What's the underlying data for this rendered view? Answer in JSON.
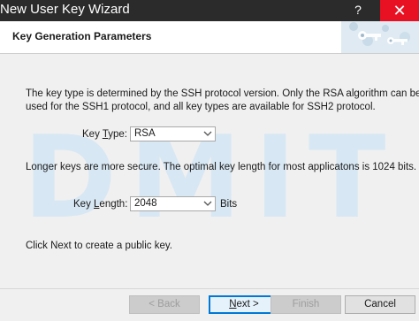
{
  "window": {
    "title": "New User Key Wizard",
    "help_label": "?",
    "close_label": "✕"
  },
  "header": {
    "title": "Key Generation Parameters"
  },
  "watermark": "DMIT",
  "content": {
    "intro_line1": "The key type is determined by the SSH protocol version. Only the RSA algorithm can be",
    "intro_line2": "used for the SSH1 protocol, and all key types are available for SSH2 protocol.",
    "key_type_label_pre": "Key ",
    "key_type_label_ul": "T",
    "key_type_label_post": "ype:",
    "key_type_value": "RSA",
    "length_note": "Longer keys are more secure. The optimal key length for most applicatons is 1024 bits.",
    "key_length_label_pre": "Key ",
    "key_length_label_ul": "L",
    "key_length_label_post": "ength:",
    "key_length_value": "2048",
    "bits_label": "Bits",
    "click_next": "Click Next to create a public key."
  },
  "buttons": {
    "back": "< Back",
    "next_ul": "N",
    "next_rest": "ext >",
    "finish": "Finish",
    "cancel": "Cancel"
  }
}
